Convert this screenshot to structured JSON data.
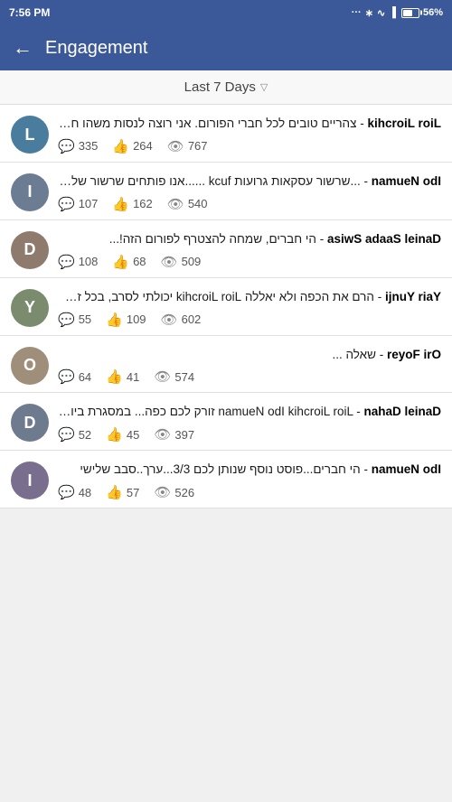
{
  "statusBar": {
    "time": "7:56 PM",
    "battery": "56%"
  },
  "header": {
    "backLabel": "←",
    "title": "Engagement"
  },
  "filter": {
    "label": "Last 7 Days",
    "dropdownArrow": "▽"
  },
  "posts": [
    {
      "id": 1,
      "authorName": "Lior Liorchik",
      "separator": " - ",
      "text": "צהריים טובים לכל חברי הפורום. אני רוצה לנסות משהו חדש כדי שנכיר קצת יותר אחד...",
      "comments": "335",
      "likes": "264",
      "views": "767",
      "avatarColor": "avatar-1",
      "avatarInitial": "L"
    },
    {
      "id": 2,
      "authorName": "Ido Neuman",
      "separator": " - ",
      "text": "...שרשור עסקאות גרועות fuck ......אנו פותחים שרשור של עסקאות גרועות שבוצעו...",
      "comments": "107",
      "likes": "162",
      "views": "540",
      "avatarColor": "avatar-2",
      "avatarInitial": "I"
    },
    {
      "id": 3,
      "authorName": "Daniel Saada Swisa",
      "separator": " - ",
      "text": "הי חברים, שמחה להצטרף לפורום הזה!...",
      "comments": "108",
      "likes": "68",
      "views": "509",
      "avatarColor": "avatar-3",
      "avatarInitial": "D"
    },
    {
      "id": 4,
      "authorName": "Yair Yunji",
      "separator": " - ",
      "text": "הרם את הכפה ולא יאללה Lior Liorchik יכולתי לסרב, בכל זאת פורום איכותי שכזה... צריך לה...",
      "comments": "55",
      "likes": "109",
      "views": "602",
      "avatarColor": "avatar-4",
      "avatarInitial": "Y"
    },
    {
      "id": 5,
      "authorName": "Ori Foyer",
      "separator": " - ",
      "text": "שאלה ...",
      "comments": "64",
      "likes": "41",
      "views": "574",
      "avatarColor": "avatar-5",
      "avatarInitial": "O"
    },
    {
      "id": 6,
      "authorName": "Daniel Dahan",
      "separator": " - ",
      "text": "Lior Liorchik Ido Neuman זורק לכם כפה... במסגרת ביוחר המושגים\\ אתרים ודי...",
      "comments": "52",
      "likes": "45",
      "views": "397",
      "avatarColor": "avatar-6",
      "avatarInitial": "D"
    },
    {
      "id": 7,
      "authorName": "Ido Neuman",
      "separator": " - ",
      "text": "הי חברים...פוסט נוסף שנותן לכם 3/3...ערך..סבב שלישי",
      "comments": "48",
      "likes": "57",
      "views": "526",
      "avatarColor": "avatar-7",
      "avatarInitial": "I"
    }
  ]
}
